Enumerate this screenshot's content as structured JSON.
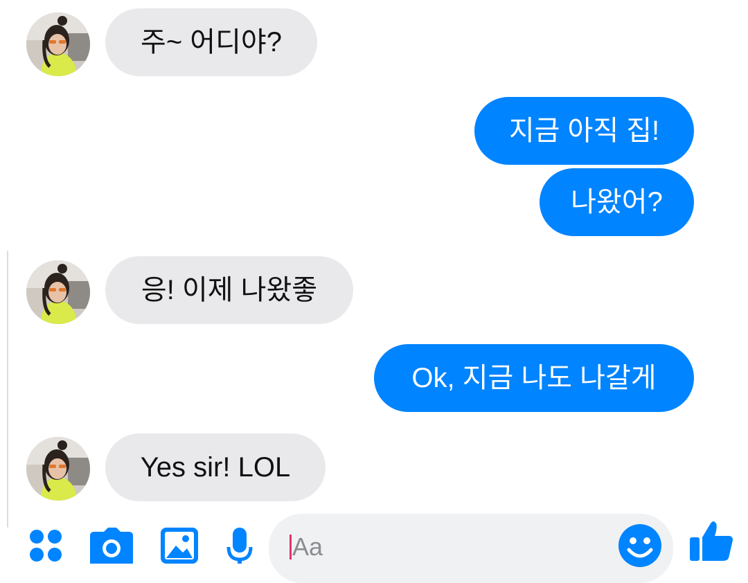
{
  "messages": [
    {
      "id": "m1",
      "from": "contact",
      "text": "주~ 어디야?"
    },
    {
      "id": "m2",
      "from": "me",
      "text": "지금 아직 집!"
    },
    {
      "id": "m3",
      "from": "me",
      "text": "나왔어?"
    },
    {
      "id": "m4",
      "from": "contact",
      "text": "응! 이제 나왔좋"
    },
    {
      "id": "m5",
      "from": "me",
      "text": "Ok, 지금 나도 나갈게"
    },
    {
      "id": "m6",
      "from": "contact",
      "text": "Yes sir! LOL"
    }
  ],
  "composer": {
    "placeholder": "Aa",
    "icons": [
      "apps-icon",
      "camera-icon",
      "gallery-icon",
      "microphone-icon",
      "emoji-icon",
      "thumbs-up-icon"
    ]
  },
  "colors": {
    "accent": "#0084ff",
    "incoming_bubble": "#e9e9eb",
    "input_background": "#f0f1f3",
    "cursor": "#e0336b"
  }
}
